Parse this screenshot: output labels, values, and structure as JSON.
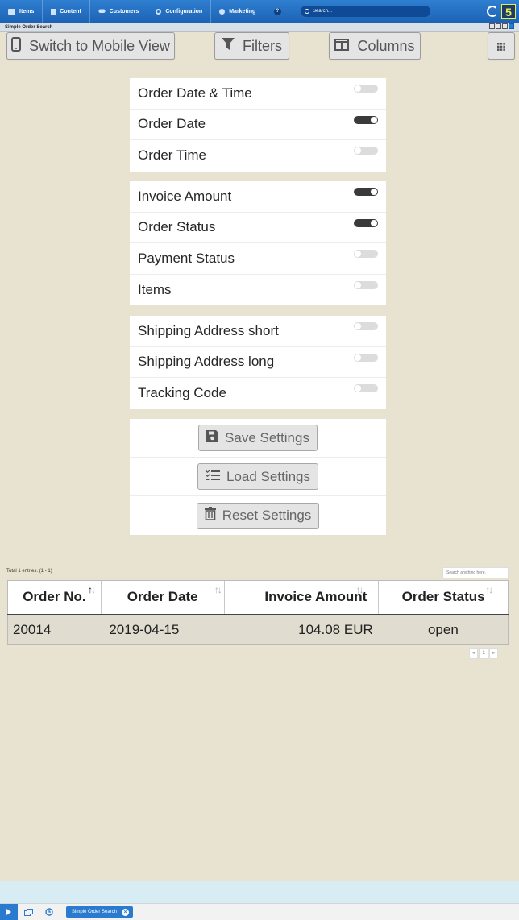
{
  "topnav": {
    "items": [
      {
        "label": "Items",
        "icon": "items-icon"
      },
      {
        "label": "Content",
        "icon": "content-icon"
      },
      {
        "label": "Customers",
        "icon": "customers-icon"
      },
      {
        "label": "Configuration",
        "icon": "configuration-icon"
      },
      {
        "label": "Marketing",
        "icon": "marketing-icon"
      }
    ],
    "help": "?",
    "search_placeholder": "Search...",
    "logo": "5"
  },
  "window": {
    "title": "Simple Order Search"
  },
  "toolbar": {
    "mobile_view": "Switch to Mobile View",
    "filters": "Filters",
    "columns": "Columns"
  },
  "column_groups": [
    [
      {
        "label": "Order Date & Time",
        "enabled": false
      },
      {
        "label": "Order Date",
        "enabled": true
      },
      {
        "label": "Order Time",
        "enabled": false
      }
    ],
    [
      {
        "label": "Invoice Amount",
        "enabled": true
      },
      {
        "label": "Order Status",
        "enabled": true
      },
      {
        "label": "Payment Status",
        "enabled": false
      },
      {
        "label": "Items",
        "enabled": false
      }
    ],
    [
      {
        "label": "Shipping Address short",
        "enabled": false
      },
      {
        "label": "Shipping Address long",
        "enabled": false
      },
      {
        "label": "Tracking Code",
        "enabled": false
      }
    ]
  ],
  "settings_actions": {
    "save": "Save Settings",
    "load": "Load Settings",
    "reset": "Reset Settings"
  },
  "table": {
    "total_text": "Total 1 entries. (1 - 1)",
    "search_placeholder": "Search anything here.",
    "headers": [
      "Order No.",
      "Order Date",
      "Invoice Amount",
      "Order Status"
    ],
    "rows": [
      [
        "20014",
        "2019-04-15",
        "104.08 EUR",
        "open"
      ]
    ],
    "pager": {
      "prev": "«",
      "page": "1",
      "next": "»"
    }
  },
  "taskbar": {
    "task_label": "Simple Order Search"
  },
  "colors": {
    "nav_blue": "#1c63b5",
    "content_bg": "#e8e3d0",
    "toggle_on": "#3a3a3a"
  }
}
